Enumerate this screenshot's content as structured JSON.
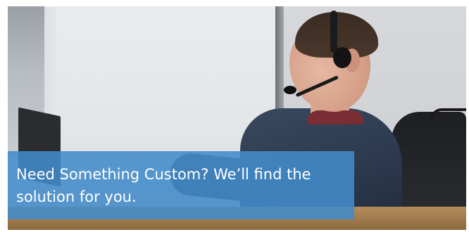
{
  "banner": {
    "image_alt_icon": "call-center-agent-photo",
    "caption": "Need Something Custom?  We’ll find the solution for you.",
    "caption_bg_color": "#428BCA",
    "caption_text_color": "#FFFFFF"
  }
}
